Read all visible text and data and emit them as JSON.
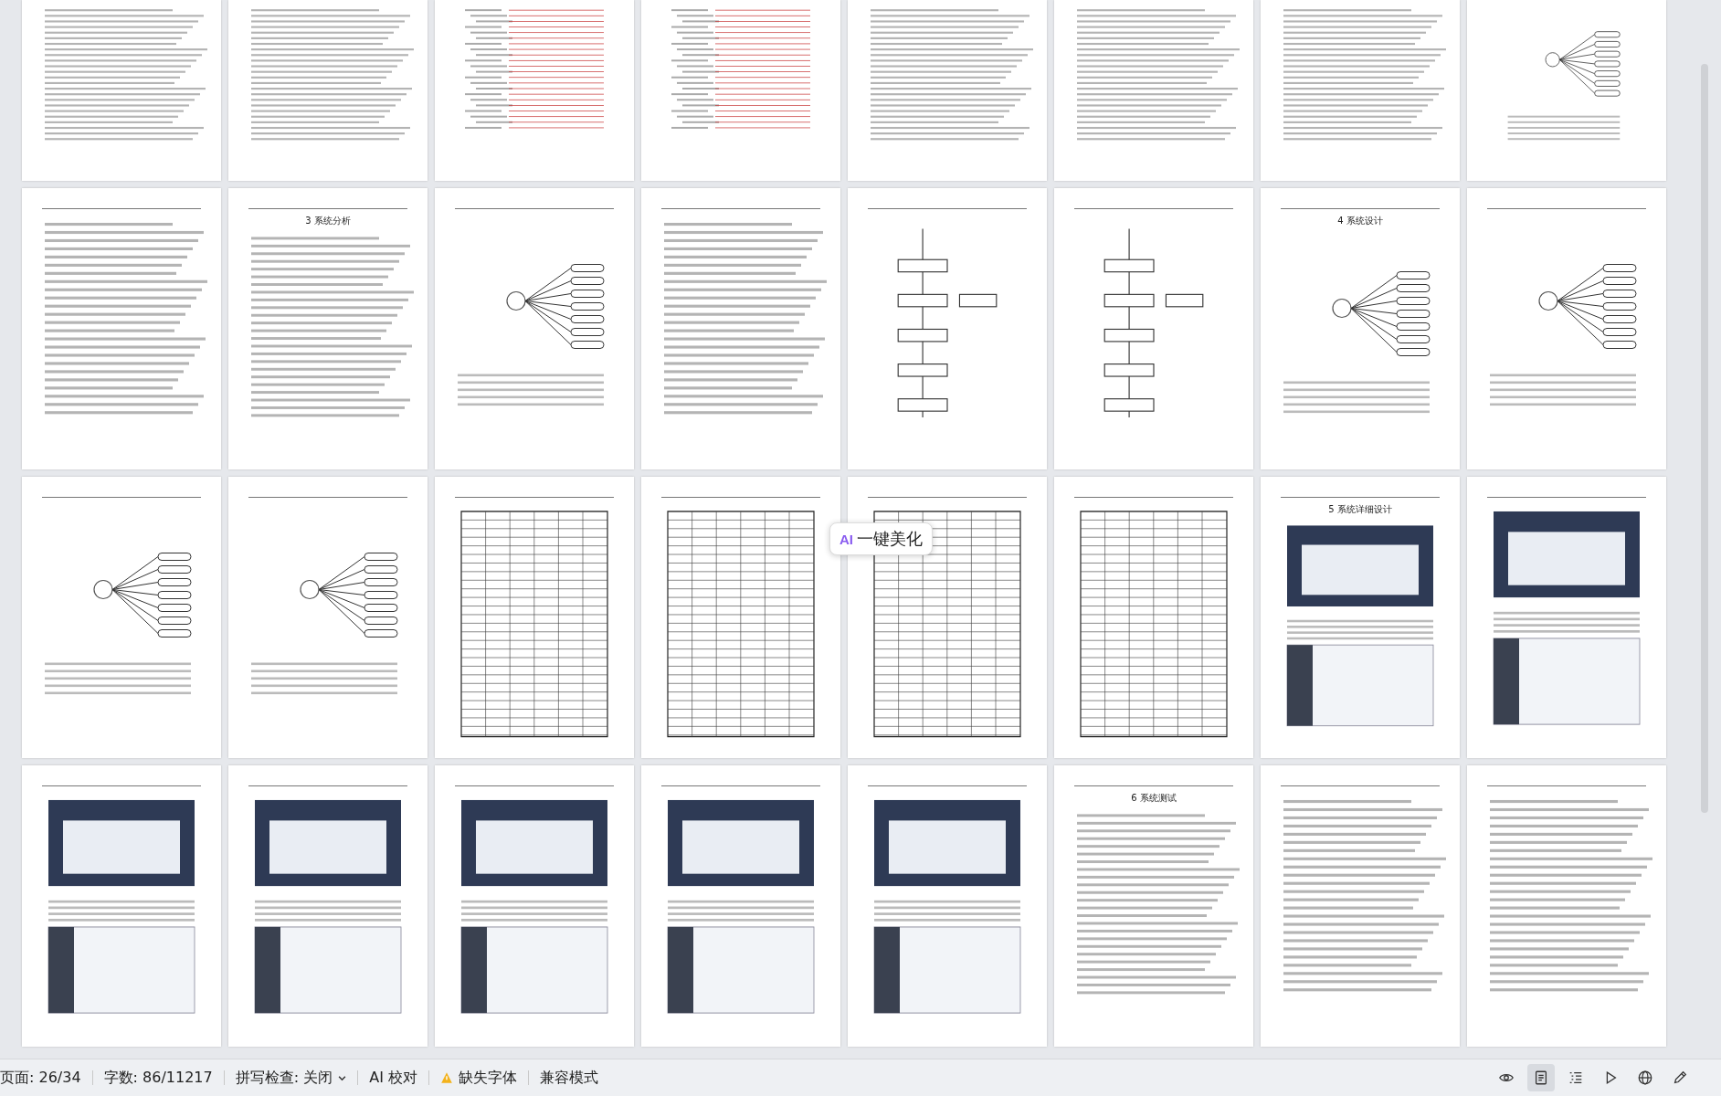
{
  "pages": [
    {
      "kind": "text"
    },
    {
      "kind": "text"
    },
    {
      "kind": "toc"
    },
    {
      "kind": "toc"
    },
    {
      "kind": "text"
    },
    {
      "kind": "text"
    },
    {
      "kind": "text"
    },
    {
      "kind": "diagram"
    },
    {
      "kind": "text"
    },
    {
      "kind": "text",
      "heading": "3 系统分析"
    },
    {
      "kind": "diagram"
    },
    {
      "kind": "text"
    },
    {
      "kind": "flow"
    },
    {
      "kind": "flow"
    },
    {
      "kind": "diagram",
      "heading": "4 系统设计"
    },
    {
      "kind": "diagram"
    },
    {
      "kind": "diagram"
    },
    {
      "kind": "diagram"
    },
    {
      "kind": "table"
    },
    {
      "kind": "table"
    },
    {
      "kind": "table"
    },
    {
      "kind": "table"
    },
    {
      "kind": "screens",
      "heading": "5 系统详细设计"
    },
    {
      "kind": "screens"
    },
    {
      "kind": "screens"
    },
    {
      "kind": "screens"
    },
    {
      "kind": "screens"
    },
    {
      "kind": "screens"
    },
    {
      "kind": "screens"
    },
    {
      "kind": "text",
      "heading": "6 系统测试"
    },
    {
      "kind": "text"
    },
    {
      "kind": "text"
    }
  ],
  "beautify_button": {
    "badge": "AI",
    "label": "一键美化"
  },
  "status_bar": {
    "page": "页面: 26/34",
    "words": "字数: 86/11217",
    "spellcheck": "拼写检查: 关闭",
    "ai_proofread": "AI 校对",
    "missing_fonts": "缺失字体",
    "compat_mode": "兼容模式"
  },
  "view_buttons": [
    {
      "kind": "eye",
      "selected": false
    },
    {
      "kind": "page",
      "selected": true
    },
    {
      "kind": "outline",
      "selected": false
    },
    {
      "kind": "play",
      "selected": false
    },
    {
      "kind": "web",
      "selected": false
    },
    {
      "kind": "pen",
      "selected": false
    }
  ]
}
